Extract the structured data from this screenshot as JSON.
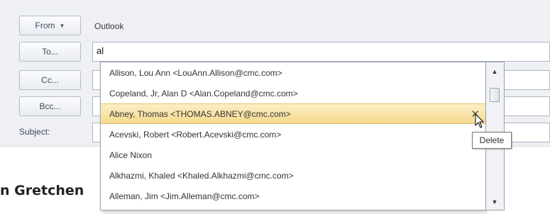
{
  "header": {
    "from_label": "From",
    "from_value": "Outlook",
    "to_label": "To...",
    "cc_label": "Cc...",
    "bcc_label": "Bcc...",
    "subject_label": "Subject:",
    "to_value": "al"
  },
  "autocomplete": {
    "items": [
      {
        "text": "Allison, Lou Ann <LouAnn.Allison@cmc.com>"
      },
      {
        "text": "Copeland, Jr, Alan D <Alan.Copeland@cmc.com>"
      },
      {
        "text": "Abney, Thomas  <THOMAS.ABNEY@cmc.com>"
      },
      {
        "text": "Acevski, Robert <Robert.Acevski@cmc.com>"
      },
      {
        "text": "Alice Nixon"
      },
      {
        "text": "Alkhazmi, Khaled <Khaled.Alkhazmi@cmc.com>"
      },
      {
        "text": "Alleman, Jim <Jim.Alleman@cmc.com>"
      }
    ],
    "selected_index": 2,
    "delete_glyph": "✕",
    "tooltip": "Delete"
  },
  "body": {
    "partial_text": "n Gretchen"
  },
  "icons": {
    "from_caret": "caret-down-icon",
    "scroll_up": "arrow-up-icon",
    "scroll_down": "arrow-down-icon",
    "delete": "delete-x-icon",
    "cursor": "mouse-pointer-icon"
  },
  "colors": {
    "selected_row": "#f5d98c",
    "header_bg": "#eef0f4"
  }
}
